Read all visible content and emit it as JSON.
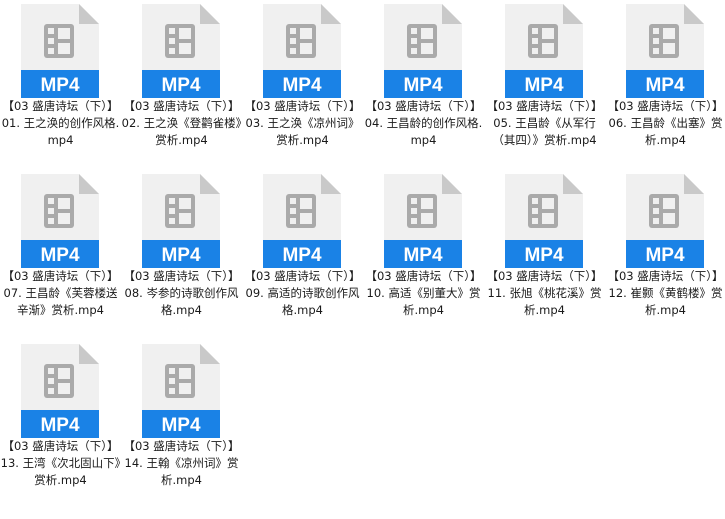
{
  "badge_color": "#1a82e6",
  "sheet_color": "#f0f0f0",
  "fold_color": "#c9c9c9",
  "icon_glyph_color": "#aaaaaa",
  "icon_name": "video-file-icon",
  "files": [
    {
      "badge": "MP4",
      "name": "【03 盛唐诗坛（下）】01. 王之涣的创作风格.mp4"
    },
    {
      "badge": "MP4",
      "name": "【03 盛唐诗坛（下）】02. 王之涣《登鹳雀楼》赏析.mp4"
    },
    {
      "badge": "MP4",
      "name": "【03 盛唐诗坛（下）】03. 王之涣《凉州词》赏析.mp4"
    },
    {
      "badge": "MP4",
      "name": "【03 盛唐诗坛（下）】04. 王昌龄的创作风格.mp4"
    },
    {
      "badge": "MP4",
      "name": "【03 盛唐诗坛（下）】05. 王昌龄《从军行（其四）》赏析.mp4"
    },
    {
      "badge": "MP4",
      "name": "【03 盛唐诗坛（下）】06. 王昌龄《出塞》赏析.mp4"
    },
    {
      "badge": "MP4",
      "name": "【03 盛唐诗坛（下）】07. 王昌龄《芙蓉楼送辛渐》赏析.mp4"
    },
    {
      "badge": "MP4",
      "name": "【03 盛唐诗坛（下）】08. 岑参的诗歌创作风格.mp4"
    },
    {
      "badge": "MP4",
      "name": "【03 盛唐诗坛（下）】09. 高适的诗歌创作风格.mp4"
    },
    {
      "badge": "MP4",
      "name": "【03 盛唐诗坛（下）】10. 高适《别董大》赏析.mp4"
    },
    {
      "badge": "MP4",
      "name": "【03 盛唐诗坛（下）】11. 张旭《桃花溪》赏析.mp4"
    },
    {
      "badge": "MP4",
      "name": "【03 盛唐诗坛（下）】12. 崔颢《黄鹤楼》赏析.mp4"
    },
    {
      "badge": "MP4",
      "name": "【03 盛唐诗坛（下）】13. 王湾《次北固山下》赏析.mp4"
    },
    {
      "badge": "MP4",
      "name": "【03 盛唐诗坛（下）】14. 王翰《凉州词》赏析.mp4"
    }
  ]
}
